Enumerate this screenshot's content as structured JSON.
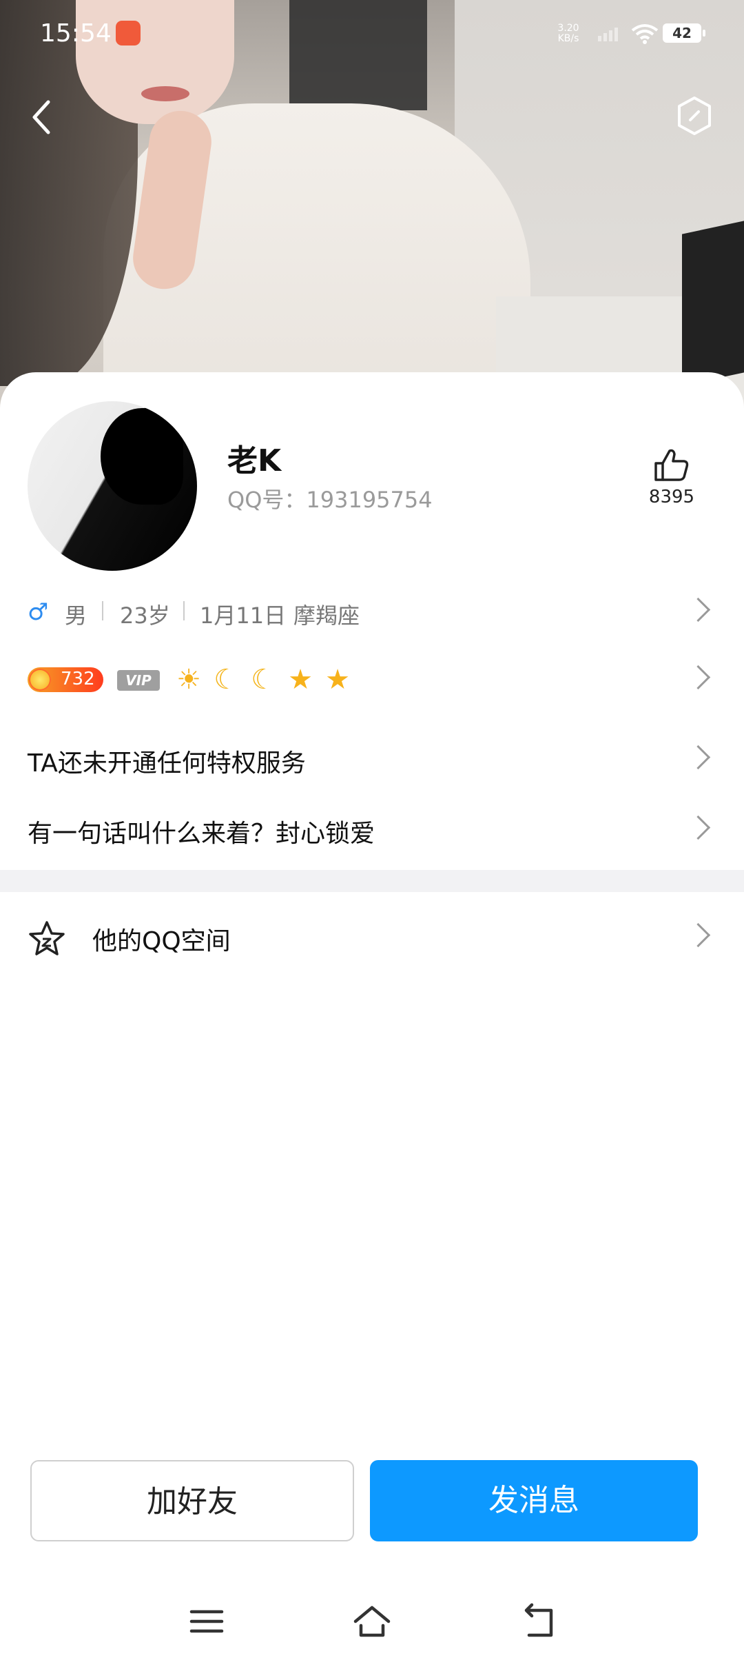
{
  "status_bar": {
    "time": "15:54",
    "net_speed_value": "3.20",
    "net_speed_unit": "KB/s",
    "battery": "42"
  },
  "profile": {
    "name": "老K",
    "qq_number": "QQ号：193195754",
    "likes": "8395"
  },
  "info": {
    "gender_symbol": "♂",
    "gender": "男",
    "age": "23岁",
    "birthday": "1月11日",
    "zodiac": "摩羯座"
  },
  "badges": {
    "level": "732",
    "vip": "VIP",
    "icons": [
      "sun-icon",
      "moon-icon",
      "moon-icon",
      "star-icon",
      "star-icon"
    ]
  },
  "rows": {
    "privilege": "TA还未开通任何特权服务",
    "signature": "有一句话叫什么来着？封心锁爱",
    "qzone": "他的QQ空间"
  },
  "buttons": {
    "add_friend": "加好友",
    "send_message": "发消息"
  },
  "colors": {
    "accent": "#0d99ff",
    "gender": "#2d8cf0"
  }
}
